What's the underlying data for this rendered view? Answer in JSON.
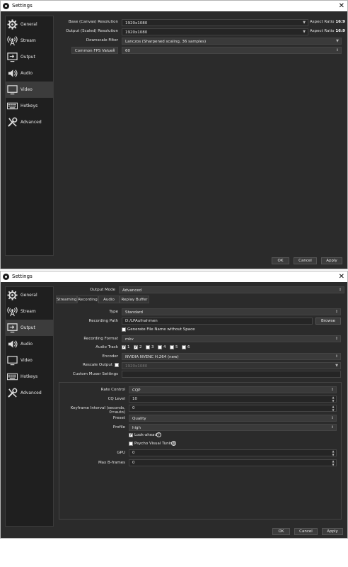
{
  "window1": {
    "title": "Settings",
    "sidebar": [
      {
        "label": "General",
        "icon": "gear-icon"
      },
      {
        "label": "Stream",
        "icon": "broadcast-icon"
      },
      {
        "label": "Output",
        "icon": "output-icon"
      },
      {
        "label": "Audio",
        "icon": "speaker-icon"
      },
      {
        "label": "Video",
        "icon": "monitor-icon"
      },
      {
        "label": "Hotkeys",
        "icon": "keyboard-icon"
      },
      {
        "label": "Advanced",
        "icon": "tools-icon"
      }
    ],
    "video": {
      "base_label": "Base (Canvas) Resolution",
      "base_value": "1920x1080",
      "base_aspect_prefix": "Aspect Ratio",
      "base_aspect_value": "16:9",
      "output_label": "Output (Scaled) Resolution",
      "output_value": "1920x1080",
      "output_aspect_prefix": "Aspect Ratio",
      "output_aspect_value": "16:9",
      "filter_label": "Downscale Filter",
      "filter_value": "Lanczos (Sharpened scaling, 36 samples)",
      "fps_label": "Common FPS Values",
      "fps_value": "60"
    },
    "buttons": {
      "ok": "OK",
      "cancel": "Cancel",
      "apply": "Apply"
    }
  },
  "window2": {
    "title": "Settings",
    "sidebar": [
      {
        "label": "General",
        "icon": "gear-icon"
      },
      {
        "label": "Stream",
        "icon": "broadcast-icon"
      },
      {
        "label": "Output",
        "icon": "output-icon"
      },
      {
        "label": "Audio",
        "icon": "speaker-icon"
      },
      {
        "label": "Video",
        "icon": "monitor-icon"
      },
      {
        "label": "Hotkeys",
        "icon": "keyboard-icon"
      },
      {
        "label": "Advanced",
        "icon": "tools-icon"
      }
    ],
    "output": {
      "mode_label": "Output Mode",
      "mode_value": "Advanced",
      "tabs": [
        "Streaming",
        "Recording",
        "Audio",
        "Replay Buffer"
      ],
      "type_label": "Type",
      "type_value": "Standard",
      "path_label": "Recording Path",
      "path_value": "D:/LPAufnahmen",
      "browse": "Browse",
      "gen_filename_label": "Generate File Name without Space",
      "format_label": "Recording Format",
      "format_value": "mkv",
      "audio_track_label": "Audio Track",
      "tracks": [
        "1",
        "2",
        "3",
        "4",
        "5",
        "6"
      ],
      "encoder_label": "Encoder",
      "encoder_value": "NVIDIA NVENC H.264 (new)",
      "rescale_label": "Rescale Output",
      "rescale_value": "1920x1080",
      "muxer_label": "Custom Muxer Settings",
      "muxer_value": "",
      "rate_control_label": "Rate Control",
      "rate_control_value": "CQP",
      "cq_label": "CQ Level",
      "cq_value": "10",
      "keyframe_label": "Keyframe Interval (seconds, 0=auto)",
      "keyframe_value": "0",
      "preset_label": "Preset",
      "preset_value": "Quality",
      "profile_label": "Profile",
      "profile_value": "high",
      "lookahead_label": "Look-ahead",
      "psycho_label": "Psycho Visual Tuning",
      "gpu_label": "GPU",
      "gpu_value": "0",
      "bframes_label": "Max B-frames",
      "bframes_value": "0"
    },
    "buttons": {
      "ok": "OK",
      "cancel": "Cancel",
      "apply": "Apply"
    }
  }
}
